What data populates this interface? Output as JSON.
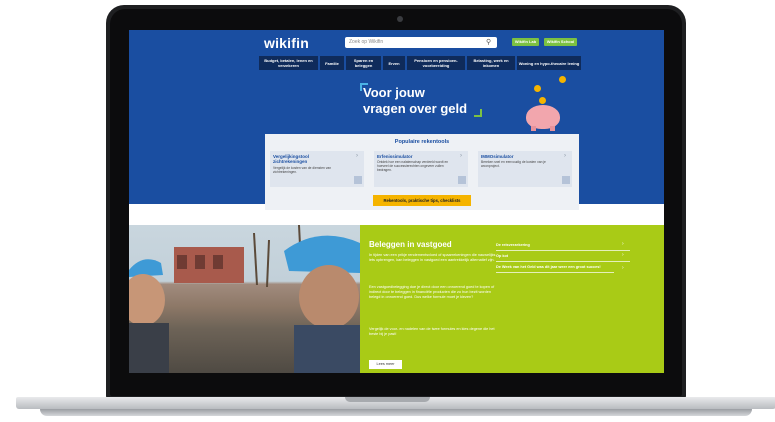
{
  "site": {
    "logo": "wikifin",
    "search_placeholder": "Zoek op Wikifin",
    "buttons": [
      "Wikifin Lab",
      "Wikifin School"
    ],
    "nav": [
      "Budget, betalen, lenen en verzekeren",
      "Familie",
      "Sparen en beleggen",
      "Erven",
      "Pensioen en pensioen-voorbereiding",
      "Belasting, werk en inkomen",
      "Woning en hypo-thecaire lening"
    ],
    "headline_line1": "Voor jouw",
    "headline_line2": "vragen over geld"
  },
  "rekentools": {
    "title": "Populaire rekentools",
    "cards": [
      {
        "title": "Vergelijkingstool zichtrekeningen",
        "text": "Vergelijk de kosten van de diensten van zichtrekeningen."
      },
      {
        "title": "Erfenissimulator",
        "text": "Ontdek hoe een nalatenschap verdeeld wordt en hoeveel de successierechten ongeveer zullen bedragen."
      },
      {
        "title": "IMMOsimulator",
        "text": "Bereken snel en eenvoudig de kosten van je woonproject."
      }
    ],
    "cta": "Rekentools, praktische tips, checklists"
  },
  "feature": {
    "title": "Beleggen in vastgoed",
    "paragraphs": [
      "In tijden van een prikje rendementsvloed of spaarrekeningen die nauwelijks iets opbrengen, kan beleggen in vastgoed een aantrekkelijk alternatief zijn.",
      "Een vastgoedbelegging doe je direct door een onroerend goed te kopen of indirect door te beleggen in financiële producten die zo hun bezit worden belegd in onroerend goed. Dus welke formule moet je kiezen?",
      "Vergelijk de voor- en nadelen van de twee formules en kies degene die het beste bij je past!"
    ],
    "button": "Lees meer",
    "links": [
      "De reisverzekering",
      "Op kot",
      "De Week van het Geld was dit jaar weer een groot succes!"
    ]
  },
  "colors": {
    "hero": "#1a4ea1",
    "nav": "#0f2b5b",
    "accent_green": "#a9cb16",
    "accent_yellow": "#f5b400"
  }
}
